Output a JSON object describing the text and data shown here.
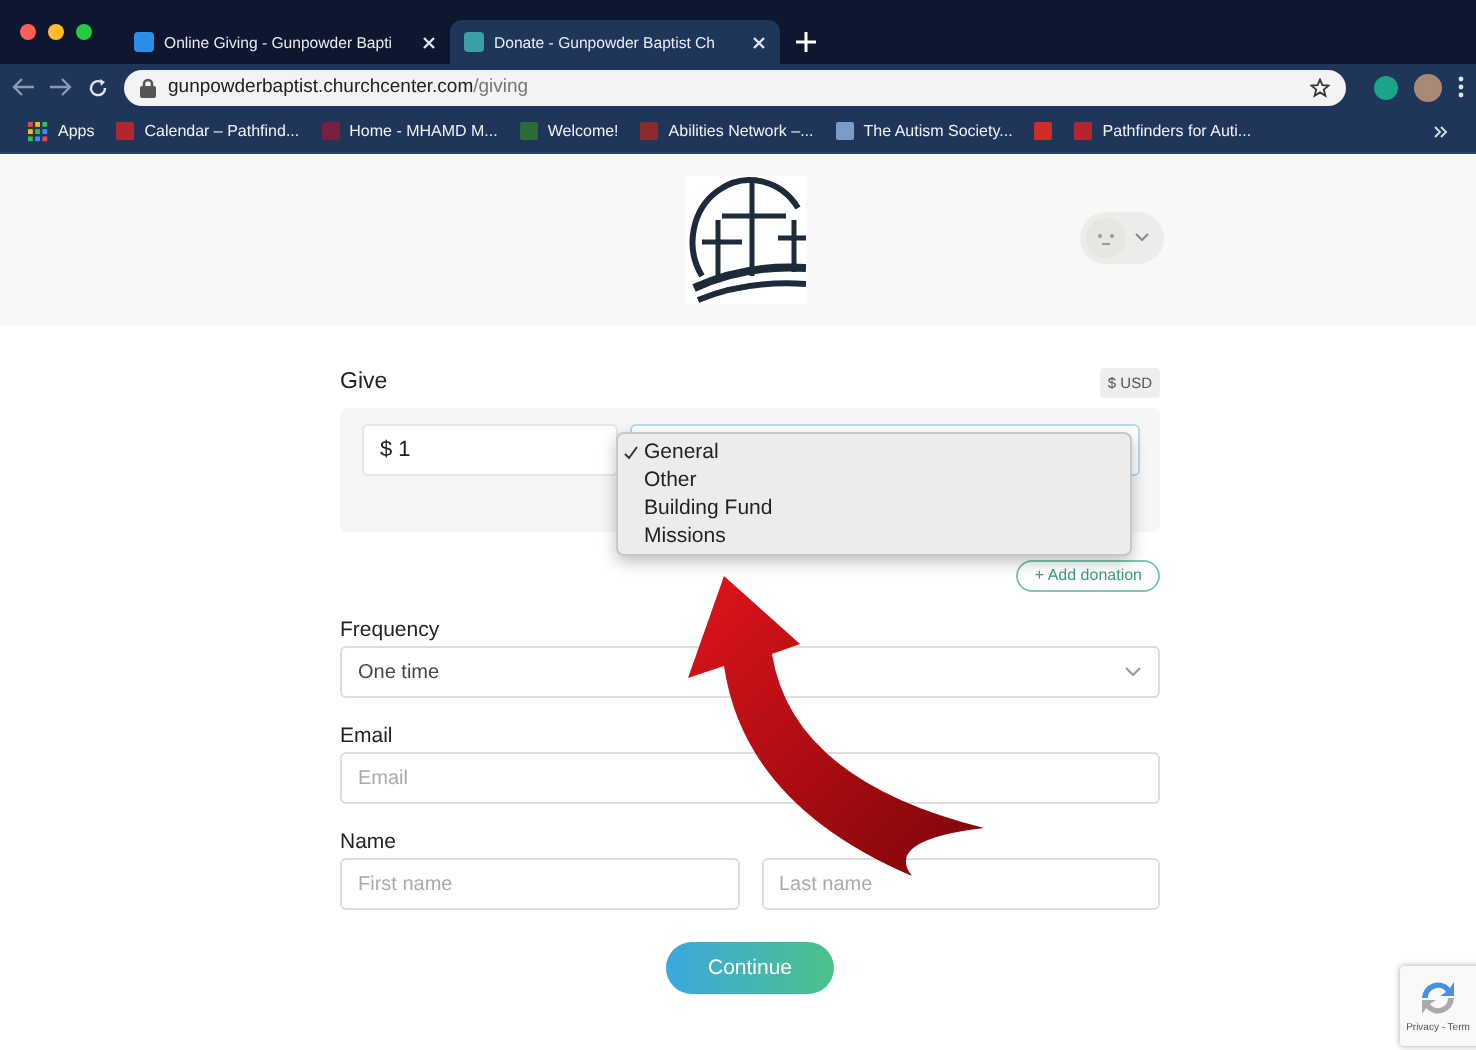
{
  "browser": {
    "tabs": [
      {
        "title": "Online Giving - Gunpowder Bapti",
        "selected": false
      },
      {
        "title": "Donate - Gunpowder Baptist Ch",
        "selected": true
      }
    ],
    "url": {
      "host": "gunpowderbaptist.churchcenter.com",
      "path": "/giving"
    },
    "apps_label": "Apps",
    "bookmarks": [
      {
        "label": "Calendar – Pathfind...",
        "color": "#b3262e"
      },
      {
        "label": "Home - MHAMD M...",
        "color": "#7a1f3d"
      },
      {
        "label": "Welcome!",
        "color": "#2d6b3a"
      },
      {
        "label": "Abilities Network –...",
        "color": "#8c2b2b"
      },
      {
        "label": "The Autism Society...",
        "color": "#7d9bc7"
      },
      {
        "color": "#d42a2a"
      },
      {
        "label": "Pathfinders for Auti...",
        "color": "#b3262e"
      }
    ]
  },
  "give": {
    "title": "Give",
    "currency": "$ USD",
    "amount": "$ 1",
    "fund_options": [
      {
        "label": "General",
        "selected": true
      },
      {
        "label": "Other",
        "selected": false
      },
      {
        "label": "Building Fund",
        "selected": false
      },
      {
        "label": "Missions",
        "selected": false
      }
    ],
    "add_donation": "+ Add donation"
  },
  "frequency": {
    "label": "Frequency",
    "value": "One time"
  },
  "email": {
    "label": "Email",
    "placeholder": "Email"
  },
  "name": {
    "label": "Name",
    "first_placeholder": "First name",
    "last_placeholder": "Last name"
  },
  "continue": "Continue",
  "recaptcha": "Privacy - Term"
}
